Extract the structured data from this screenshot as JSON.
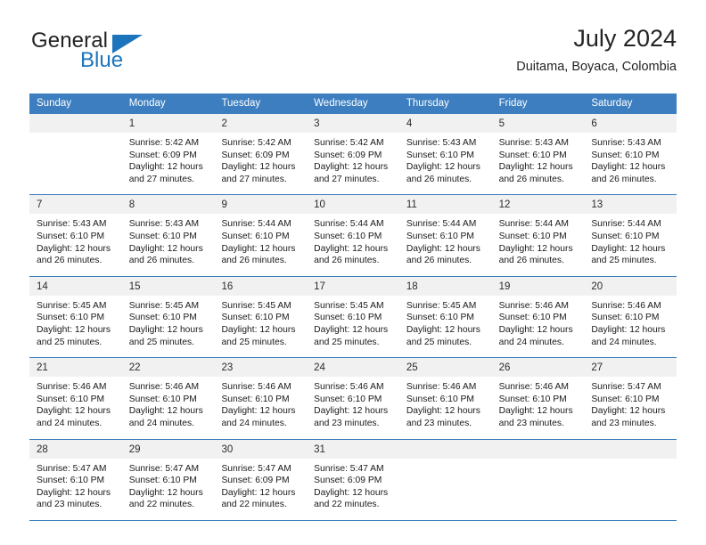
{
  "brand": {
    "name_part1": "General",
    "name_part2": "Blue",
    "accent_color": "#1c75bc",
    "logo_icon": "triangle-icon"
  },
  "header": {
    "title": "July 2024",
    "subtitle": "Duitama, Boyaca, Colombia"
  },
  "calendar": {
    "header_bg": "#3c7ebf",
    "daynum_bg": "#f1f1f1",
    "weekday_headers": [
      "Sunday",
      "Monday",
      "Tuesday",
      "Wednesday",
      "Thursday",
      "Friday",
      "Saturday"
    ],
    "weeks": [
      {
        "days": [
          {
            "num": "",
            "lines": []
          },
          {
            "num": "1",
            "lines": [
              "Sunrise: 5:42 AM",
              "Sunset: 6:09 PM",
              "Daylight: 12 hours",
              "and 27 minutes."
            ]
          },
          {
            "num": "2",
            "lines": [
              "Sunrise: 5:42 AM",
              "Sunset: 6:09 PM",
              "Daylight: 12 hours",
              "and 27 minutes."
            ]
          },
          {
            "num": "3",
            "lines": [
              "Sunrise: 5:42 AM",
              "Sunset: 6:09 PM",
              "Daylight: 12 hours",
              "and 27 minutes."
            ]
          },
          {
            "num": "4",
            "lines": [
              "Sunrise: 5:43 AM",
              "Sunset: 6:10 PM",
              "Daylight: 12 hours",
              "and 26 minutes."
            ]
          },
          {
            "num": "5",
            "lines": [
              "Sunrise: 5:43 AM",
              "Sunset: 6:10 PM",
              "Daylight: 12 hours",
              "and 26 minutes."
            ]
          },
          {
            "num": "6",
            "lines": [
              "Sunrise: 5:43 AM",
              "Sunset: 6:10 PM",
              "Daylight: 12 hours",
              "and 26 minutes."
            ]
          }
        ]
      },
      {
        "days": [
          {
            "num": "7",
            "lines": [
              "Sunrise: 5:43 AM",
              "Sunset: 6:10 PM",
              "Daylight: 12 hours",
              "and 26 minutes."
            ]
          },
          {
            "num": "8",
            "lines": [
              "Sunrise: 5:43 AM",
              "Sunset: 6:10 PM",
              "Daylight: 12 hours",
              "and 26 minutes."
            ]
          },
          {
            "num": "9",
            "lines": [
              "Sunrise: 5:44 AM",
              "Sunset: 6:10 PM",
              "Daylight: 12 hours",
              "and 26 minutes."
            ]
          },
          {
            "num": "10",
            "lines": [
              "Sunrise: 5:44 AM",
              "Sunset: 6:10 PM",
              "Daylight: 12 hours",
              "and 26 minutes."
            ]
          },
          {
            "num": "11",
            "lines": [
              "Sunrise: 5:44 AM",
              "Sunset: 6:10 PM",
              "Daylight: 12 hours",
              "and 26 minutes."
            ]
          },
          {
            "num": "12",
            "lines": [
              "Sunrise: 5:44 AM",
              "Sunset: 6:10 PM",
              "Daylight: 12 hours",
              "and 26 minutes."
            ]
          },
          {
            "num": "13",
            "lines": [
              "Sunrise: 5:44 AM",
              "Sunset: 6:10 PM",
              "Daylight: 12 hours",
              "and 25 minutes."
            ]
          }
        ]
      },
      {
        "days": [
          {
            "num": "14",
            "lines": [
              "Sunrise: 5:45 AM",
              "Sunset: 6:10 PM",
              "Daylight: 12 hours",
              "and 25 minutes."
            ]
          },
          {
            "num": "15",
            "lines": [
              "Sunrise: 5:45 AM",
              "Sunset: 6:10 PM",
              "Daylight: 12 hours",
              "and 25 minutes."
            ]
          },
          {
            "num": "16",
            "lines": [
              "Sunrise: 5:45 AM",
              "Sunset: 6:10 PM",
              "Daylight: 12 hours",
              "and 25 minutes."
            ]
          },
          {
            "num": "17",
            "lines": [
              "Sunrise: 5:45 AM",
              "Sunset: 6:10 PM",
              "Daylight: 12 hours",
              "and 25 minutes."
            ]
          },
          {
            "num": "18",
            "lines": [
              "Sunrise: 5:45 AM",
              "Sunset: 6:10 PM",
              "Daylight: 12 hours",
              "and 25 minutes."
            ]
          },
          {
            "num": "19",
            "lines": [
              "Sunrise: 5:46 AM",
              "Sunset: 6:10 PM",
              "Daylight: 12 hours",
              "and 24 minutes."
            ]
          },
          {
            "num": "20",
            "lines": [
              "Sunrise: 5:46 AM",
              "Sunset: 6:10 PM",
              "Daylight: 12 hours",
              "and 24 minutes."
            ]
          }
        ]
      },
      {
        "days": [
          {
            "num": "21",
            "lines": [
              "Sunrise: 5:46 AM",
              "Sunset: 6:10 PM",
              "Daylight: 12 hours",
              "and 24 minutes."
            ]
          },
          {
            "num": "22",
            "lines": [
              "Sunrise: 5:46 AM",
              "Sunset: 6:10 PM",
              "Daylight: 12 hours",
              "and 24 minutes."
            ]
          },
          {
            "num": "23",
            "lines": [
              "Sunrise: 5:46 AM",
              "Sunset: 6:10 PM",
              "Daylight: 12 hours",
              "and 24 minutes."
            ]
          },
          {
            "num": "24",
            "lines": [
              "Sunrise: 5:46 AM",
              "Sunset: 6:10 PM",
              "Daylight: 12 hours",
              "and 23 minutes."
            ]
          },
          {
            "num": "25",
            "lines": [
              "Sunrise: 5:46 AM",
              "Sunset: 6:10 PM",
              "Daylight: 12 hours",
              "and 23 minutes."
            ]
          },
          {
            "num": "26",
            "lines": [
              "Sunrise: 5:46 AM",
              "Sunset: 6:10 PM",
              "Daylight: 12 hours",
              "and 23 minutes."
            ]
          },
          {
            "num": "27",
            "lines": [
              "Sunrise: 5:47 AM",
              "Sunset: 6:10 PM",
              "Daylight: 12 hours",
              "and 23 minutes."
            ]
          }
        ]
      },
      {
        "days": [
          {
            "num": "28",
            "lines": [
              "Sunrise: 5:47 AM",
              "Sunset: 6:10 PM",
              "Daylight: 12 hours",
              "and 23 minutes."
            ]
          },
          {
            "num": "29",
            "lines": [
              "Sunrise: 5:47 AM",
              "Sunset: 6:10 PM",
              "Daylight: 12 hours",
              "and 22 minutes."
            ]
          },
          {
            "num": "30",
            "lines": [
              "Sunrise: 5:47 AM",
              "Sunset: 6:09 PM",
              "Daylight: 12 hours",
              "and 22 minutes."
            ]
          },
          {
            "num": "31",
            "lines": [
              "Sunrise: 5:47 AM",
              "Sunset: 6:09 PM",
              "Daylight: 12 hours",
              "and 22 minutes."
            ]
          },
          {
            "num": "",
            "lines": []
          },
          {
            "num": "",
            "lines": []
          },
          {
            "num": "",
            "lines": []
          }
        ]
      }
    ]
  }
}
